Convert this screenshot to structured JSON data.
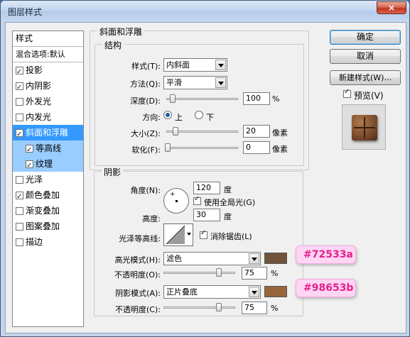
{
  "window": {
    "title": "图层样式",
    "close_glyph": "×"
  },
  "style_list": {
    "header": "样式",
    "blend_options": "混合选项:默认",
    "items": [
      {
        "label": "投影",
        "checked": true
      },
      {
        "label": "内阴影",
        "checked": true
      },
      {
        "label": "外发光",
        "checked": false
      },
      {
        "label": "内发光",
        "checked": false
      },
      {
        "label": "斜面和浮雕",
        "checked": true,
        "selected": true
      },
      {
        "label": "等高线",
        "checked": true,
        "sub": true
      },
      {
        "label": "纹理",
        "checked": true,
        "sub": true
      },
      {
        "label": "光泽",
        "checked": false
      },
      {
        "label": "颜色叠加",
        "checked": true
      },
      {
        "label": "渐变叠加",
        "checked": false
      },
      {
        "label": "图案叠加",
        "checked": false
      },
      {
        "label": "描边",
        "checked": false
      }
    ]
  },
  "bevel": {
    "group_label": "斜面和浮雕",
    "structure_label": "结构",
    "style_label": "样式(T):",
    "style_value": "内斜面",
    "technique_label": "方法(Q):",
    "technique_value": "平滑",
    "depth_label": "深度(D):",
    "depth_value": "100",
    "depth_unit": "%",
    "direction_label": "方向:",
    "direction_up": "上",
    "direction_down": "下",
    "size_label": "大小(Z):",
    "size_value": "20",
    "size_unit": "像素",
    "soften_label": "软化(F):",
    "soften_value": "0",
    "soften_unit": "像素"
  },
  "shading": {
    "group_label": "阴影",
    "angle_label": "角度(N):",
    "angle_value": "120",
    "angle_unit": "度",
    "global_light_label": "使用全局光(G)",
    "altitude_label": "高度:",
    "altitude_value": "30",
    "altitude_unit": "度",
    "gloss_contour_label": "光泽等高线:",
    "anti_aliased_label": "消除锯齿(L)",
    "highlight_mode_label": "高光模式(H):",
    "highlight_mode_value": "滤色",
    "highlight_color": "#72533a",
    "highlight_callout": "#72533a",
    "highlight_opacity_label": "不透明度(O):",
    "highlight_opacity_value": "75",
    "highlight_opacity_unit": "%",
    "shadow_mode_label": "阴影模式(A):",
    "shadow_mode_value": "正片叠底",
    "shadow_color": "#98653b",
    "shadow_callout": "#98653b",
    "shadow_opacity_label": "不透明度(C):",
    "shadow_opacity_value": "75",
    "shadow_opacity_unit": "%"
  },
  "buttons": {
    "ok": "确定",
    "cancel": "取消",
    "new_style": "新建样式(W)...",
    "preview": "预览(V)"
  }
}
